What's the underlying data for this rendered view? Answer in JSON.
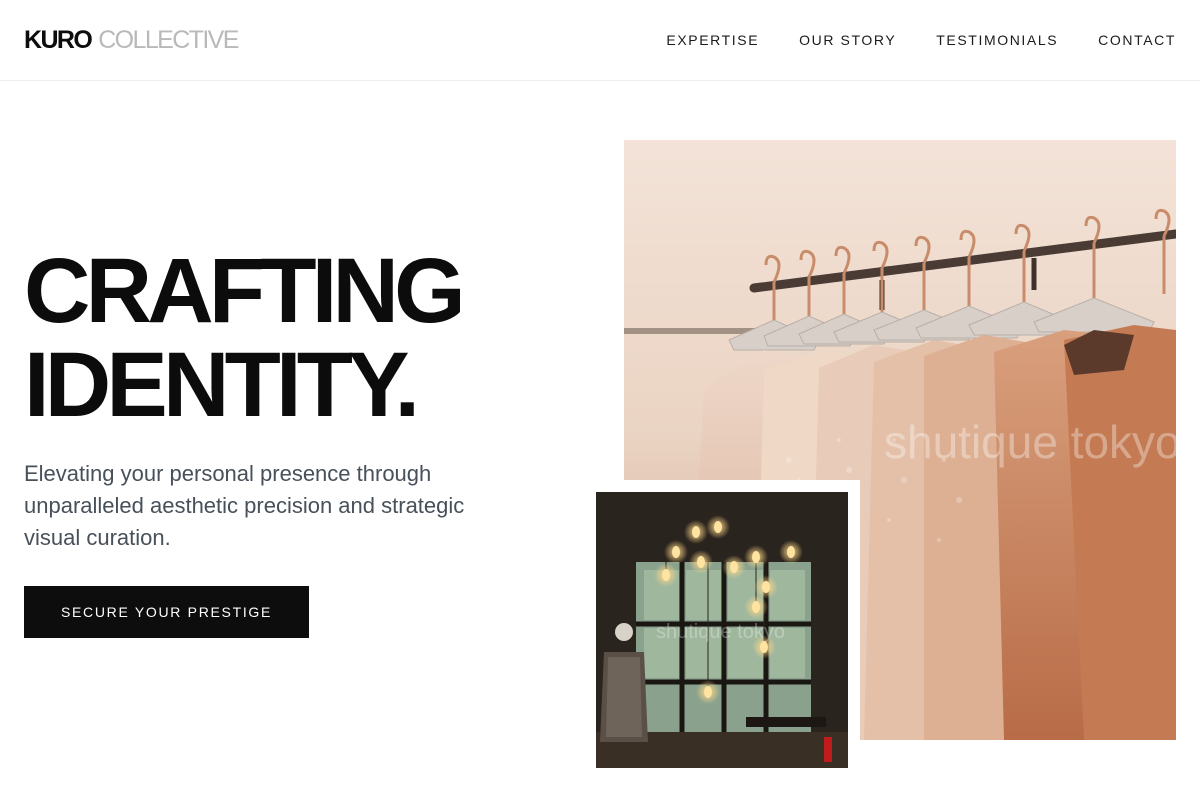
{
  "header": {
    "logo_primary": "KURO",
    "logo_secondary": "COLLECTIVE",
    "nav": [
      "EXPERTISE",
      "OUR STORY",
      "TESTIMONIALS",
      "CONTACT"
    ]
  },
  "hero": {
    "title_line1": "CRAFTING",
    "title_line2": "IDENTITY.",
    "subtitle": "Elevating your personal presence through unparalleled aesthetic precision and strategic visual curation.",
    "cta_label": "SECURE YOUR PRESTIGE"
  },
  "colors": {
    "text": "#0d0d0d",
    "muted_logo": "#b9b9b9",
    "subtitle": "#48505a",
    "cta_bg": "#0d0d0d",
    "cta_text": "#ffffff"
  },
  "images": {
    "main": "clothing-rack-photo",
    "inset": "boutique-interior-photo",
    "main_watermark": "shutique tokyo",
    "inset_watermark": "shutique tokyo"
  }
}
